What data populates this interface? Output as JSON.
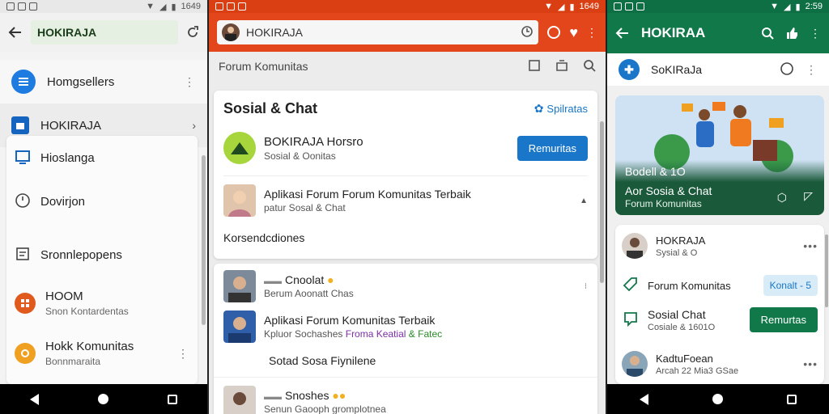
{
  "status": {
    "time_left": "1649",
    "time_mid": "1649",
    "time_right": "2:59"
  },
  "p1": {
    "search_value": "HOKIRAJA",
    "rows": [
      {
        "label": "Homgsellers"
      },
      {
        "label": "HOKIRAJA"
      }
    ],
    "items": [
      {
        "label": "Hioslanga",
        "sub": ""
      },
      {
        "label": "Dovirjon",
        "sub": ""
      },
      {
        "label": "Sronnlepopens",
        "sub": ""
      },
      {
        "label": "HOOM",
        "sub": "Snon Kontardentas"
      },
      {
        "label": "Hokk Komunitas",
        "sub": "Bonnmaraita"
      }
    ]
  },
  "p2": {
    "search_value": "HOKIRAJA",
    "subbar_label": "Forum Komunitas",
    "card1": {
      "title": "Sosial & Chat",
      "link": "Spilratas",
      "item1_title": "BOKIRAJA Horsro",
      "item1_sub": "Sosial & Oonitas",
      "button": "Remuritas",
      "item2_title": "Aplikasi Forum Forum Komunitas Terbaik",
      "item2_sub": "patur Sosal & Chat",
      "footer": "Korsendcdiones"
    },
    "card2": {
      "post1_title": "Cnoolat",
      "post1_sub": "Berum Aoonatt Chas",
      "post2_title": "Aplikasi Forum Komunitas Terbaik",
      "post2_sub_a": "Kpluor Sochashes ",
      "post2_sub_b": "Froma Keatial",
      "post2_sub_c": " & Fatec",
      "post3_title": "Sotad Sosa Fiynilene",
      "post4_title": "Snoshes",
      "post4_sub": "Senun Gaooph gromplotnea"
    }
  },
  "p3": {
    "title": "HOKIRAA",
    "subbar_label": "SoKIRaJa",
    "banner": {
      "caption_small": "Bodell & 1O",
      "caption_title": "Aor Sosia & Chat",
      "caption_sub": "Forum Komunitas"
    },
    "items": [
      {
        "title": "HOKRAJA",
        "sub": "Sysial & O"
      },
      {
        "title": "Forum Komunitas",
        "badge": "Konalt - 5"
      },
      {
        "title": "Sosial Chat",
        "sub": "Cosiale & 1601O",
        "button": "Remurtas"
      },
      {
        "title": "KadtuFoean",
        "sub": "Arcah 22 Mia3 GSae"
      }
    ]
  },
  "colors": {
    "p2_bar": "#e2461a",
    "p3_bar": "#11784a",
    "primary_blue": "#1976c8",
    "p3_button": "#11784a"
  }
}
